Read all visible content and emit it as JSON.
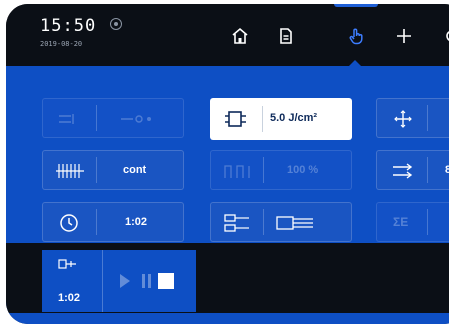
{
  "status": {
    "time": "15:50",
    "date": "2019-08-20",
    "indicator_icon": "status-indicator-icon"
  },
  "nav": {
    "items": [
      {
        "name": "home",
        "icon": "home-icon"
      },
      {
        "name": "document",
        "icon": "document-icon"
      },
      {
        "name": "touch",
        "icon": "hand-pointer-icon",
        "active": true
      },
      {
        "name": "add",
        "icon": "plus-icon"
      }
    ]
  },
  "controls": {
    "fluence": {
      "value": "5.0 J/cm²",
      "icon": "pulse-module-icon"
    },
    "mode": {
      "value": "cont",
      "icon": "pulse-train-icon"
    },
    "power": {
      "value": "100 %",
      "icon": "power-step-icon"
    },
    "timer": {
      "value": "1:02",
      "icon": "clock-icon"
    },
    "sum": {
      "label": "ΣE"
    },
    "bottom_timer": {
      "value": "1:02",
      "icon": "applicator-icon"
    }
  },
  "colors": {
    "panel": "#0e4fc4",
    "topbar": "#0b0f16",
    "accent": "#1e5fd6"
  }
}
